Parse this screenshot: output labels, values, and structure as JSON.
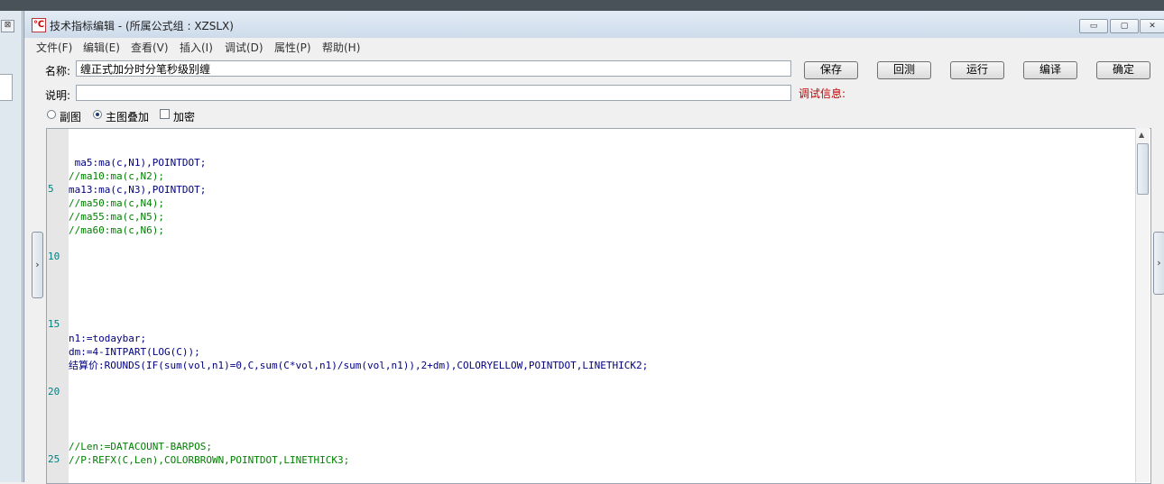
{
  "window": {
    "title": "技术指标编辑 - (所属公式组 : XZSLX)",
    "app_icon": "formula-editor-icon",
    "controls": {
      "minimize": "▭",
      "maximize": "▢",
      "close": "✕"
    }
  },
  "left_pane": {
    "button": "⊠"
  },
  "menu": [
    "文件(F)",
    "编辑(E)",
    "查看(V)",
    "插入(I)",
    "调试(D)",
    "属性(P)",
    "帮助(H)"
  ],
  "form": {
    "name_label": "名称:",
    "name_value": "缠正式加分时分笔秒级别缠",
    "desc_label": "说明:",
    "desc_value": "",
    "debug_label": "调试信息:"
  },
  "buttons": {
    "save": "保存",
    "revert": "回测",
    "run": "运行",
    "compile": "编译",
    "ok": "确定"
  },
  "options": {
    "sub_chart": {
      "label": "副图",
      "selected": false
    },
    "main_overlay": {
      "label": "主图叠加",
      "selected": true
    },
    "encrypt": {
      "label": "加密",
      "checked": false
    }
  },
  "editor": {
    "line_numbers": [
      "5",
      "10",
      "15",
      "20",
      "25"
    ],
    "code_lines": [
      " ma5:ma(c,N1),POINTDOT;",
      "//ma10:ma(c,N2);",
      "ma13:ma(c,N3),POINTDOT;",
      "//ma50:ma(c,N4);",
      "//ma55:ma(c,N5);",
      "//ma60:ma(c,N6);",
      "n1:=todaybar;",
      "dm:=4-INTPART(LOG(C));",
      "结算价:ROUNDS(IF(sum(vol,n1)=0,C,sum(C*vol,n1)/sum(vol,n1)),2+dm),COLORYELLOW,POINTDOT,LINETHICK2;",
      "//Len:=DATACOUNT-BARPOS;",
      "//P:REFX(C,Len),COLORBROWN,POINTDOT,LINETHICK3;"
    ]
  },
  "colors": {
    "debug_text": "#c00000",
    "comment": "#008000",
    "keyword": "#000080",
    "line_number": "#008080"
  }
}
